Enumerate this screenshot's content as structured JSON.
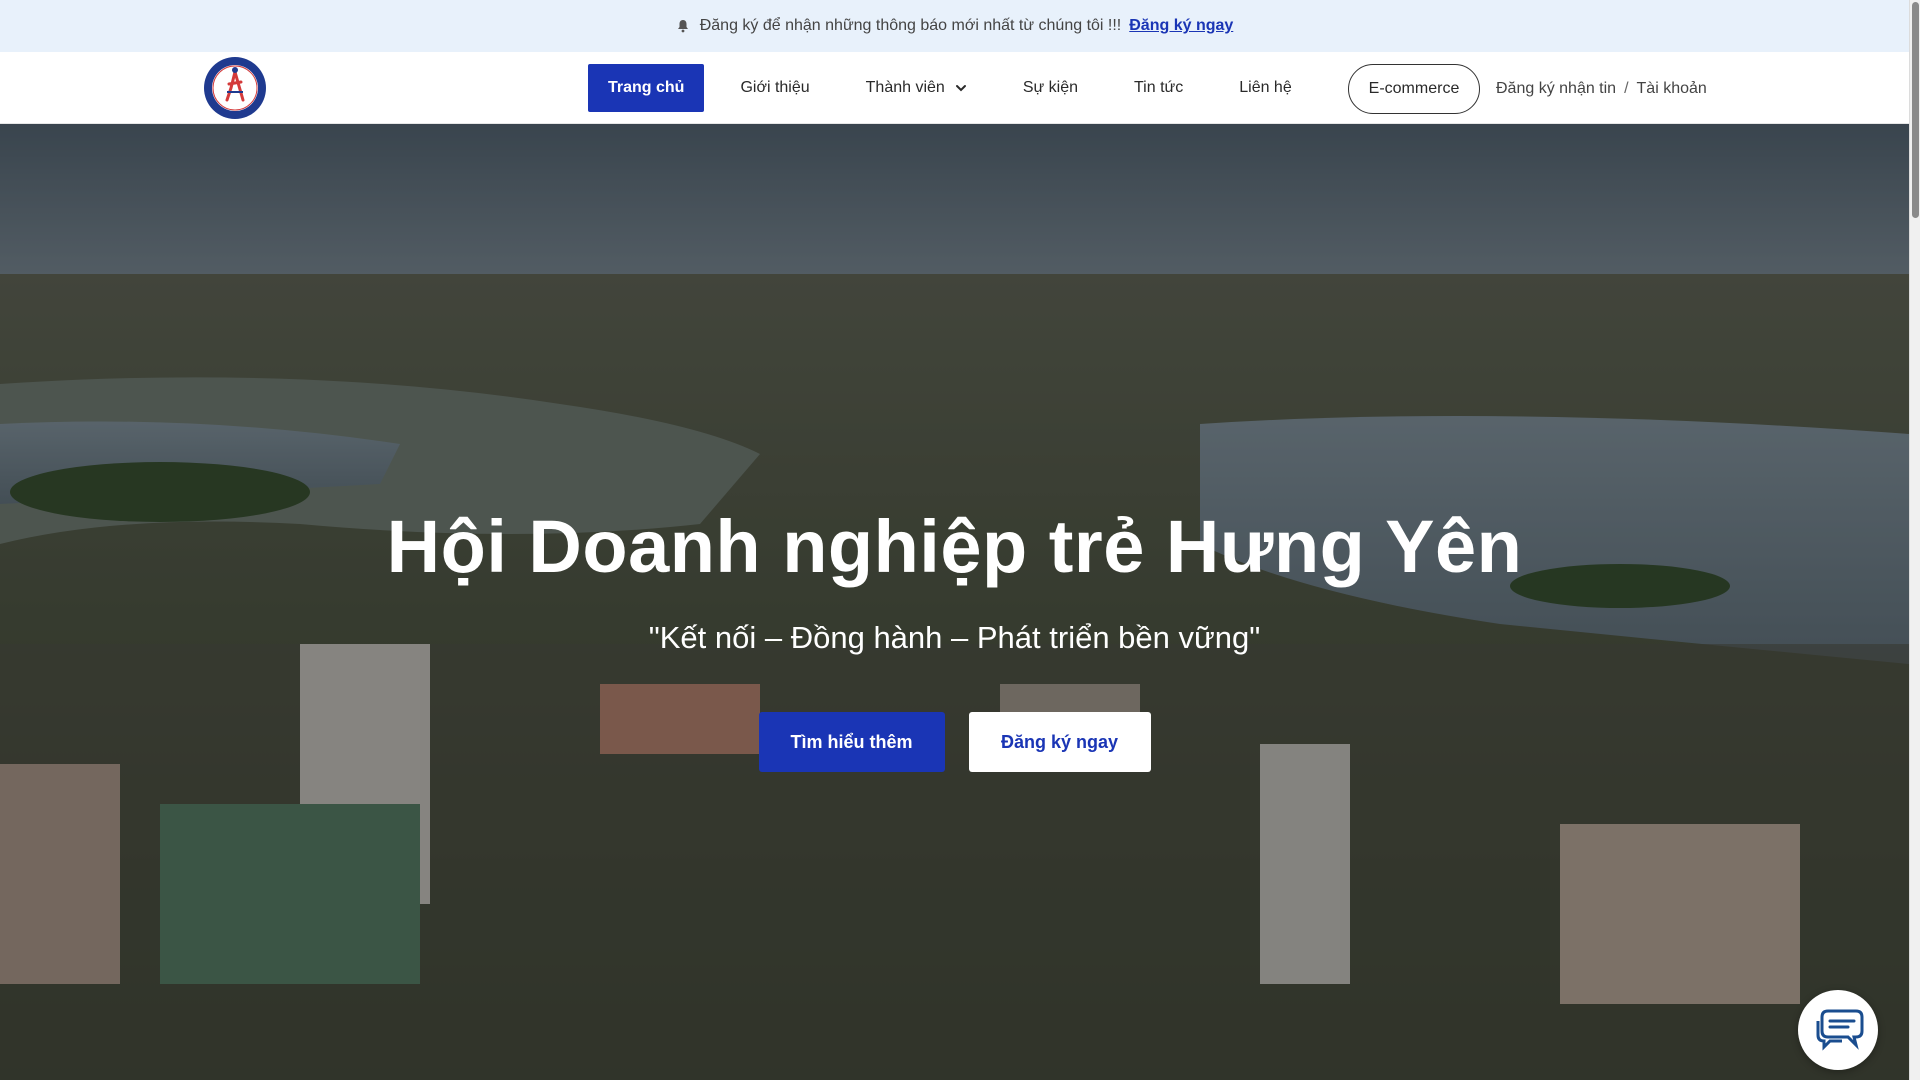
{
  "topbar": {
    "notice": "Đăng ký để nhận những thông báo mới nhất từ chúng tôi !!!",
    "signup_link": "Đăng ký ngay",
    "icon": "bell-icon"
  },
  "header": {
    "logo_alt": "Hội Doanh nghiệp trẻ Hưng Yên logo",
    "nav": [
      {
        "label": "Trang chủ",
        "active": true
      },
      {
        "label": "Giới thiệu"
      },
      {
        "label": "Thành viên",
        "dropdown": true
      },
      {
        "label": "Sự kiện"
      },
      {
        "label": "Tin tức"
      },
      {
        "label": "Liên hệ"
      }
    ],
    "ecommerce": "E-commerce",
    "account": {
      "subscribe": "Đăng ký nhận tin",
      "separator": "/",
      "account": "Tài khoản"
    }
  },
  "hero": {
    "title": "Hội Doanh nghiệp trẻ Hưng Yên",
    "subtitle": "\"Kết nối – Đồng hành – Phát triển bền vững\"",
    "primary_button": "Tìm hiểu thêm",
    "secondary_button": "Đăng ký ngay"
  },
  "chat": {
    "icon": "chat-icon"
  },
  "colors": {
    "brand": "#1a35b5",
    "topbar_bg": "#e8f1fb"
  }
}
